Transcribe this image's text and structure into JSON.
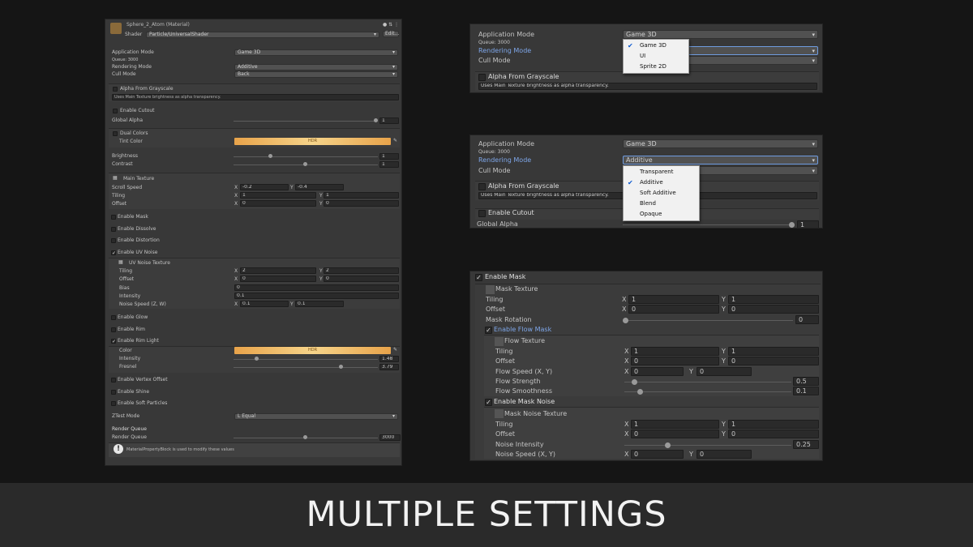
{
  "left": {
    "title": "Sphere_2_Atom (Material)",
    "shader_label": "Shader",
    "shader_value": "Particle/UniversalShader",
    "edit_label": "Edit...",
    "app_mode_label": "Application Mode",
    "app_mode_value": "Game 3D",
    "queue": "Queue: 3000",
    "render_mode_label": "Rendering Mode",
    "render_mode_value": "Additive",
    "cull_label": "Cull Mode",
    "cull_value": "Back",
    "alpha_gray": "Alpha From Grayscale",
    "alpha_gray_help": "Uses Main Texture brightness as alpha transparency.",
    "cutout": "Enable Cutout",
    "global_alpha": "Global Alpha",
    "global_alpha_val": "1",
    "dual_colors": "Dual Colors",
    "tint_color": "Tint Color",
    "hdr": "HDR",
    "brightness": "Brightness",
    "brightness_val": "1",
    "contrast": "Contrast",
    "contrast_val": "1",
    "main_texture": "Main Texture",
    "scroll_speed": "Scroll Speed",
    "scroll_x": "-0.2",
    "scroll_y": "-0.4",
    "tiling": "Tiling",
    "tiling_x": "1",
    "tiling_y": "1",
    "offset": "Offset",
    "offset_x": "0",
    "offset_y": "0",
    "mask": "Enable Mask",
    "dissolve": "Enable Dissolve",
    "distortion": "Enable Distortion",
    "uv_noise": "Enable UV Noise",
    "uv_noise_tex": "UV Noise Texture",
    "uvn_tiling_x": "2",
    "uvn_tiling_y": "2",
    "uvn_offset_x": "0",
    "uvn_offset_y": "0",
    "bias": "Bias",
    "bias_val": "0",
    "intensity": "Intensity",
    "intensity_val": "0.1",
    "noise_speed": "Noise Speed (Z, W)",
    "noise_speed_x": "0.1",
    "noise_speed_y": "0.1",
    "glow": "Enable Glow",
    "rim": "Enable Rim",
    "rim_light": "Enable Rim Light",
    "color": "Color",
    "rl_intensity_val": "1.48",
    "fresnel": "Fresnel",
    "fresnel_val": "3.79",
    "vertex_offset": "Enable Vertex Offset",
    "shine": "Enable Shine",
    "soft_particles": "Enable Soft Particles",
    "ztest_label": "ZTest Mode",
    "ztest_value": "L Equal",
    "render_queue_header": "Render Queue",
    "render_queue_label": "Render Queue",
    "render_queue_val": "3000",
    "info_text": "MaterialPropertyBlock is used to modify these values",
    "x": "X",
    "y": "Y"
  },
  "p1": {
    "app_mode_label": "Application Mode",
    "app_mode_value": "Game 3D",
    "queue": "Queue: 3000",
    "render_mode_label": "Rendering Mode",
    "cull_label": "Cull Mode",
    "alpha_gray": "Alpha From Grayscale",
    "alpha_gray_help": "Uses Main Texture brightness as alpha transparency.",
    "menu": [
      "Game 3D",
      "UI",
      "Sprite 2D"
    ]
  },
  "p2": {
    "app_mode_label": "Application Mode",
    "app_mode_value": "Game 3D",
    "queue": "Queue: 3000",
    "render_mode_label": "Rendering Mode",
    "render_mode_value": "Additive",
    "cull_label": "Cull Mode",
    "alpha_gray": "Alpha From Grayscale",
    "alpha_gray_help": "Uses Main Texture brightness as alpha transparency.",
    "cutout": "Enable Cutout",
    "global_alpha": "Global Alpha",
    "global_alpha_val": "1",
    "menu": [
      "Transparent",
      "Additive",
      "Soft Additive",
      "Blend",
      "Opaque"
    ]
  },
  "p3": {
    "enable_mask": "Enable Mask",
    "mask_texture": "Mask Texture",
    "tiling": "Tiling",
    "offset": "Offset",
    "t_x": "1",
    "t_y": "1",
    "o_x": "0",
    "o_y": "0",
    "mask_rotation": "Mask Rotation",
    "mask_rotation_val": "0",
    "flow_mask": "Enable Flow Mask",
    "flow_texture": "Flow Texture",
    "ft_x": "1",
    "ft_y": "1",
    "fo_x": "0",
    "fo_y": "0",
    "flow_speed": "Flow Speed (X, Y)",
    "fs_x": "0",
    "fs_y": "0",
    "flow_strength": "Flow Strength",
    "flow_strength_val": "0.5",
    "flow_smoothness": "Flow Smoothness",
    "flow_smoothness_val": "0.1",
    "mask_noise": "Enable Mask Noise",
    "mask_noise_texture": "Mask Noise Texture",
    "nt_x": "1",
    "nt_y": "1",
    "no_x": "0",
    "no_y": "0",
    "noise_intensity": "Noise Intensity",
    "noise_intensity_val": "0.25",
    "noise_speed": "Noise Speed (X, Y)",
    "ns_x": "0",
    "ns_y": "0",
    "x": "X",
    "y": "Y"
  },
  "banner": "MULTIPLE SETTINGS",
  "colors": {
    "hdr_gradient_start": "#e8a34a",
    "hdr_gradient_end": "#f6d48a",
    "accent_blue": "#7ea6e8"
  }
}
